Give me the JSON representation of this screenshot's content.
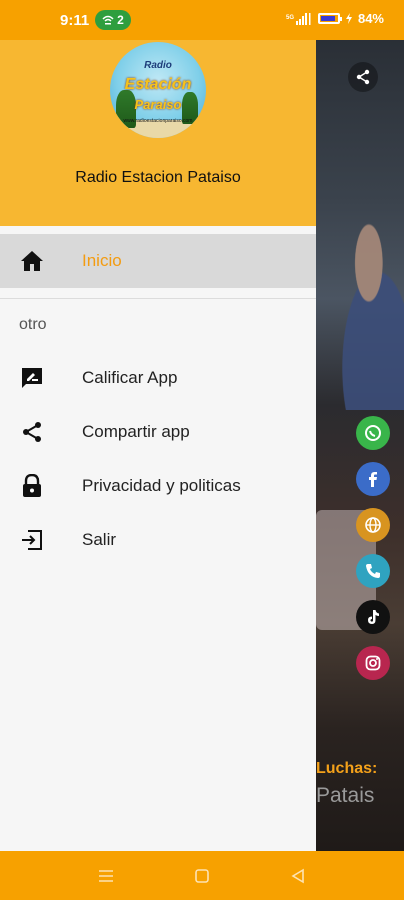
{
  "status_bar": {
    "time": "9:11",
    "hotspot_count": "2",
    "network": "5G",
    "battery_percent": "84%"
  },
  "drawer": {
    "station_name": "Radio Estacion Pataiso",
    "logo_text": {
      "line1": "Radio",
      "line2": "Estación",
      "line3": "Paraiso",
      "line4": "www.radioestacionparaiso.com"
    },
    "active_item": {
      "label": "Inicio",
      "icon": "home-icon"
    },
    "section_label": "otro",
    "items": [
      {
        "label": "Calificar App",
        "icon": "rate-review-icon"
      },
      {
        "label": "Compartir app",
        "icon": "share-icon"
      },
      {
        "label": "Privacidad y politicas",
        "icon": "lock-icon"
      },
      {
        "label": "Salir",
        "icon": "exit-icon"
      }
    ]
  },
  "background_app": {
    "ticker_line1": "Luchas:",
    "ticker_line2": "Patais",
    "social_icons": [
      "whatsapp-icon",
      "facebook-icon",
      "web-icon",
      "phone-icon",
      "tiktok-icon",
      "instagram-icon"
    ]
  },
  "colors": {
    "accent": "#f7a100",
    "header": "#f7b731",
    "active_text": "#f39c12",
    "drawer_bg": "#f6f6f6"
  }
}
